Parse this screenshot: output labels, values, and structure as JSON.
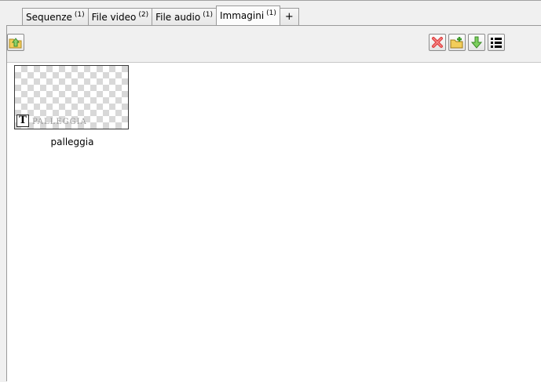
{
  "tabs": [
    {
      "label": "Sequenze",
      "count": "(1)"
    },
    {
      "label": "File video",
      "count": "(2)"
    },
    {
      "label": "File audio",
      "count": "(1)"
    },
    {
      "label": "Immagini",
      "count": "(1)",
      "active": true
    },
    {
      "label": "+"
    }
  ],
  "toolbar": {
    "left": [
      {
        "icon": "folder-up-icon",
        "color": "#f0c040"
      }
    ],
    "right": [
      {
        "icon": "red-x-icon",
        "color": "#e04040"
      },
      {
        "icon": "new-folder-icon",
        "color": "#f0c040"
      },
      {
        "icon": "green-down-arrow-icon",
        "color": "#5cbf4a"
      },
      {
        "icon": "list-view-icon",
        "color": "#000000"
      }
    ]
  },
  "items": [
    {
      "name": "palleggia",
      "type_badge": "T",
      "thumb_text": "PALLEGGIA"
    }
  ]
}
